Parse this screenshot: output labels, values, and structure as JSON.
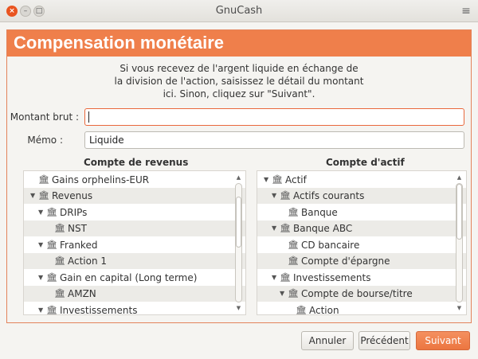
{
  "window": {
    "title": "GnuCash",
    "close_icon": "×",
    "min_icon": "–",
    "max_icon": "□",
    "menu_icon": "≡"
  },
  "page": {
    "title": "Compensation monétaire",
    "instructions": [
      "Si vous recevez de l'argent liquide en échange de",
      "la division de l'action, saisissez le détail du montant",
      "ici. Sinon, cliquez sur \"Suivant\"."
    ]
  },
  "form": {
    "amount_label": "Montant brut :",
    "amount_value": "",
    "memo_label": "Mémo :",
    "memo_value": "Liquide"
  },
  "income_tree": {
    "title": "Compte de revenus",
    "rows": [
      {
        "label": "Gains orphelins-EUR",
        "indent": 0,
        "expander": "",
        "alt": false
      },
      {
        "label": "Revenus",
        "indent": 0,
        "expander": "▼",
        "alt": true
      },
      {
        "label": "DRIPs",
        "indent": 1,
        "expander": "▼",
        "alt": false
      },
      {
        "label": "NST",
        "indent": 2,
        "expander": "",
        "alt": true
      },
      {
        "label": "Franked",
        "indent": 1,
        "expander": "▼",
        "alt": false
      },
      {
        "label": "Action 1",
        "indent": 2,
        "expander": "",
        "alt": true
      },
      {
        "label": "Gain en capital (Long terme)",
        "indent": 1,
        "expander": "▼",
        "alt": false
      },
      {
        "label": "AMZN",
        "indent": 2,
        "expander": "",
        "alt": true
      },
      {
        "label": "Investissements",
        "indent": 1,
        "expander": "▼",
        "alt": false
      }
    ]
  },
  "asset_tree": {
    "title": "Compte d'actif",
    "rows": [
      {
        "label": "Actif",
        "indent": 0,
        "expander": "▼",
        "alt": false
      },
      {
        "label": "Actifs courants",
        "indent": 1,
        "expander": "▼",
        "alt": true
      },
      {
        "label": "Banque",
        "indent": 2,
        "expander": "",
        "alt": false
      },
      {
        "label": "Banque ABC",
        "indent": 1,
        "expander": "▼",
        "alt": true
      },
      {
        "label": "CD bancaire",
        "indent": 2,
        "expander": "",
        "alt": false
      },
      {
        "label": "Compte d'épargne",
        "indent": 2,
        "expander": "",
        "alt": true
      },
      {
        "label": "Investissements",
        "indent": 1,
        "expander": "▼",
        "alt": false
      },
      {
        "label": "Compte de bourse/titre",
        "indent": 2,
        "expander": "▼",
        "alt": true
      },
      {
        "label": "Action",
        "indent": 3,
        "expander": "",
        "alt": false
      }
    ]
  },
  "buttons": {
    "cancel": "Annuler",
    "previous": "Précédent",
    "next": "Suivant"
  },
  "colors": {
    "accent": "#ef7f4b",
    "close_button": "#e95420"
  },
  "icons": {
    "account": "🏛",
    "scroll_up": "▲",
    "scroll_down": "▼"
  }
}
